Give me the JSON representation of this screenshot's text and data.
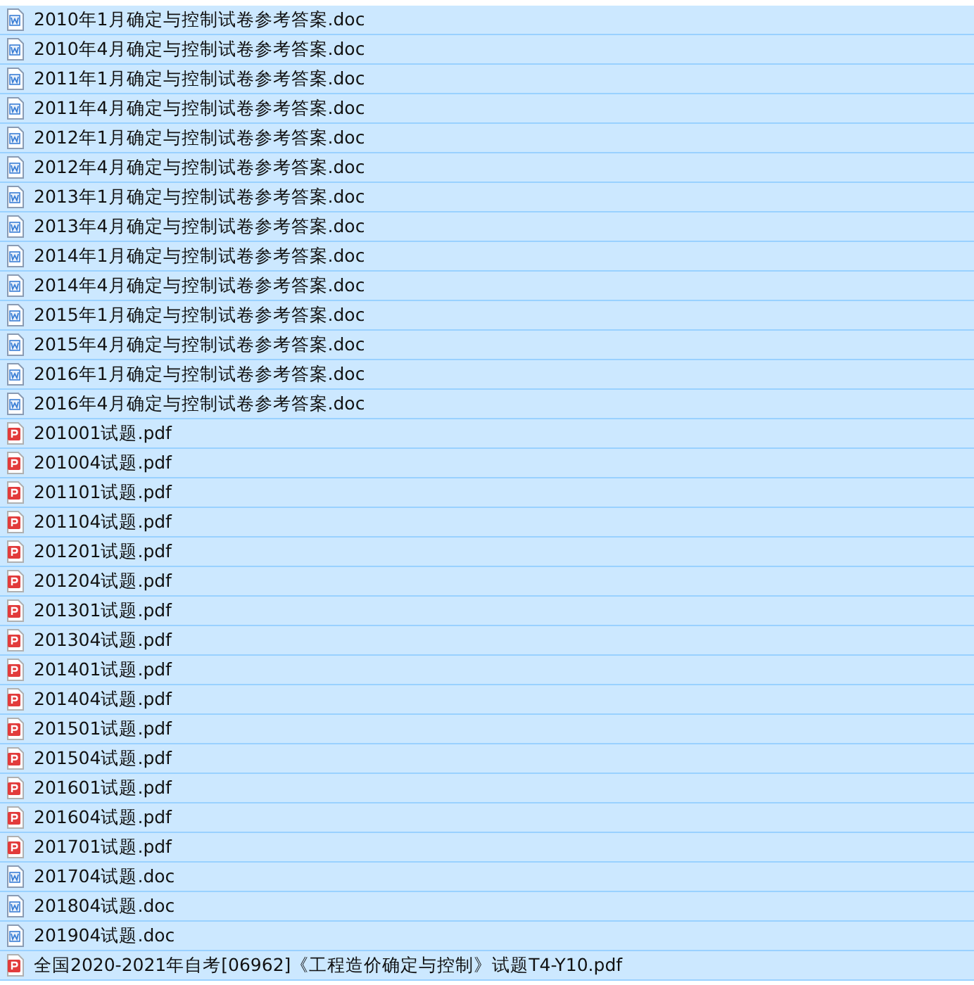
{
  "files": [
    {
      "name": "2010年1月确定与控制试卷参考答案.doc",
      "kind": "doc",
      "selected": true
    },
    {
      "name": "2010年4月确定与控制试卷参考答案.doc",
      "kind": "doc",
      "selected": true
    },
    {
      "name": "2011年1月确定与控制试卷参考答案.doc",
      "kind": "doc",
      "selected": true
    },
    {
      "name": "2011年4月确定与控制试卷参考答案.doc",
      "kind": "doc",
      "selected": true
    },
    {
      "name": "2012年1月确定与控制试卷参考答案.doc",
      "kind": "doc",
      "selected": true
    },
    {
      "name": "2012年4月确定与控制试卷参考答案.doc",
      "kind": "doc",
      "selected": true
    },
    {
      "name": "2013年1月确定与控制试卷参考答案.doc",
      "kind": "doc",
      "selected": true
    },
    {
      "name": "2013年4月确定与控制试卷参考答案.doc",
      "kind": "doc",
      "selected": true
    },
    {
      "name": "2014年1月确定与控制试卷参考答案.doc",
      "kind": "doc",
      "selected": true
    },
    {
      "name": "2014年4月确定与控制试卷参考答案.doc",
      "kind": "doc",
      "selected": true
    },
    {
      "name": "2015年1月确定与控制试卷参考答案.doc",
      "kind": "doc",
      "selected": true
    },
    {
      "name": "2015年4月确定与控制试卷参考答案.doc",
      "kind": "doc",
      "selected": true
    },
    {
      "name": "2016年1月确定与控制试卷参考答案.doc",
      "kind": "doc",
      "selected": true
    },
    {
      "name": "2016年4月确定与控制试卷参考答案.doc",
      "kind": "doc",
      "selected": true
    },
    {
      "name": "201001试题.pdf",
      "kind": "pdf",
      "selected": true
    },
    {
      "name": "201004试题.pdf",
      "kind": "pdf",
      "selected": true
    },
    {
      "name": "201101试题.pdf",
      "kind": "pdf",
      "selected": true
    },
    {
      "name": "201104试题.pdf",
      "kind": "pdf",
      "selected": true
    },
    {
      "name": "201201试题.pdf",
      "kind": "pdf",
      "selected": true
    },
    {
      "name": "201204试题.pdf",
      "kind": "pdf",
      "selected": true
    },
    {
      "name": "201301试题.pdf",
      "kind": "pdf",
      "selected": true
    },
    {
      "name": "201304试题.pdf",
      "kind": "pdf",
      "selected": true
    },
    {
      "name": "201401试题.pdf",
      "kind": "pdf",
      "selected": true
    },
    {
      "name": "201404试题.pdf",
      "kind": "pdf",
      "selected": true
    },
    {
      "name": "201501试题.pdf",
      "kind": "pdf",
      "selected": true
    },
    {
      "name": "201504试题.pdf",
      "kind": "pdf",
      "selected": true
    },
    {
      "name": "201601试题.pdf",
      "kind": "pdf",
      "selected": true
    },
    {
      "name": "201604试题.pdf",
      "kind": "pdf",
      "selected": true
    },
    {
      "name": "201701试题.pdf",
      "kind": "pdf",
      "selected": true
    },
    {
      "name": "201704试题.doc",
      "kind": "doc",
      "selected": true
    },
    {
      "name": "201804试题.doc",
      "kind": "doc",
      "selected": true
    },
    {
      "name": "201904试题.doc",
      "kind": "doc",
      "selected": true
    },
    {
      "name": "全国2020-2021年自考[06962]《工程造价确定与控制》试题T4-Y10.pdf",
      "kind": "pdf",
      "selected": true
    }
  ]
}
